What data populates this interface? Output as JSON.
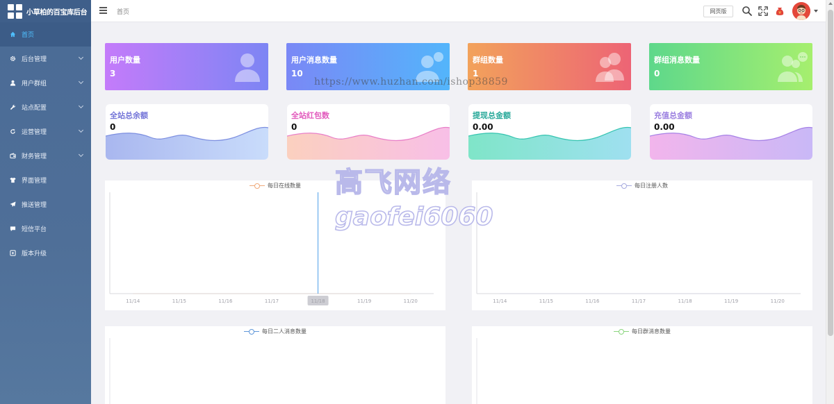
{
  "app": {
    "title": "小草柏的百宝库后台"
  },
  "sidebar": {
    "items": [
      {
        "label": "首页",
        "icon": "home-icon",
        "active": true,
        "expandable": false
      },
      {
        "label": "后台管理",
        "icon": "gear-icon",
        "expandable": true
      },
      {
        "label": "用户群组",
        "icon": "user-icon",
        "expandable": true
      },
      {
        "label": "站点配置",
        "icon": "wrench-icon",
        "expandable": true
      },
      {
        "label": "运营管理",
        "icon": "refresh-icon",
        "expandable": true
      },
      {
        "label": "财务管理",
        "icon": "wallet-icon",
        "expandable": true
      },
      {
        "label": "界面管理",
        "icon": "shirt-icon",
        "expandable": false
      },
      {
        "label": "推送管理",
        "icon": "paper-plane-icon",
        "expandable": false
      },
      {
        "label": "短信平台",
        "icon": "comment-icon",
        "expandable": false
      },
      {
        "label": "版本升级",
        "icon": "upgrade-icon",
        "expandable": false
      }
    ]
  },
  "header": {
    "breadcrumb": "首页",
    "home_page_button": "网页版",
    "icons": [
      "search-icon",
      "fullscreen-icon",
      "money-bag-icon",
      "avatar"
    ]
  },
  "stat_cards": [
    {
      "label": "用户数量",
      "value": "3",
      "icon": "user-icon",
      "gradient": [
        "#c47bfa",
        "#7d85f4"
      ]
    },
    {
      "label": "用户消息数量",
      "value": "10",
      "icon": "user-message-icon",
      "gradient": [
        "#7a88f6",
        "#53b5fb"
      ]
    },
    {
      "label": "群组数量",
      "value": "1",
      "icon": "group-icon",
      "gradient": [
        "#f2a25b",
        "#ed6475"
      ]
    },
    {
      "label": "群组消息数量",
      "value": "0",
      "icon": "group-message-icon",
      "gradient": [
        "#5ed88b",
        "#a6ef6e"
      ]
    }
  ],
  "wave_cards": [
    {
      "label": "全站总余额",
      "value": "0",
      "label_color": "#7475d8",
      "fill": [
        "#a9b7ef",
        "#c9dcfb"
      ],
      "stroke": "#7d8fe0"
    },
    {
      "label": "全站红包数",
      "value": "0",
      "label_color": "#e25bbd",
      "fill": [
        "#fbd0bf",
        "#f8bfe7"
      ],
      "stroke": "#e87fc8"
    },
    {
      "label": "提现总金额",
      "value": "0.00",
      "label_color": "#29a99a",
      "fill": [
        "#7fe5c8",
        "#9fe0f0"
      ],
      "stroke": "#35c4b0"
    },
    {
      "label": "充值总金额",
      "value": "0.00",
      "label_color": "#9b7fe0",
      "fill": [
        "#f2b5ec",
        "#c9b8f7"
      ],
      "stroke": "#a681e6"
    }
  ],
  "chart_data": [
    {
      "type": "line",
      "title": "",
      "series": [
        {
          "name": "每日在线数量",
          "color": "#f0a97a",
          "values": [
            0,
            0,
            0,
            0,
            0,
            0,
            0
          ]
        }
      ],
      "categories": [
        "11/14",
        "11/15",
        "11/16",
        "11/17",
        "11/18",
        "11/19",
        "11/20"
      ],
      "highlight": "11/18"
    },
    {
      "type": "line",
      "title": "",
      "series": [
        {
          "name": "每日注册人数",
          "color": "#a6aadf",
          "values": [
            0,
            0,
            0,
            0,
            0,
            0,
            0
          ]
        }
      ],
      "categories": [
        "11/14",
        "11/15",
        "11/16",
        "11/17",
        "11/18",
        "11/19",
        "11/20"
      ]
    },
    {
      "type": "line",
      "title": "",
      "series": [
        {
          "name": "每日二人消息数量",
          "color": "#5f97d9",
          "values": []
        }
      ],
      "categories": []
    },
    {
      "type": "line",
      "title": "",
      "series": [
        {
          "name": "每日群消息数量",
          "color": "#8ad57e",
          "values": []
        }
      ],
      "categories": []
    }
  ],
  "watermarks": {
    "url": "https://www.huzhan.com/ishop38859",
    "brand_cn": "高飞网络",
    "brand_en": "gaofei6060"
  }
}
